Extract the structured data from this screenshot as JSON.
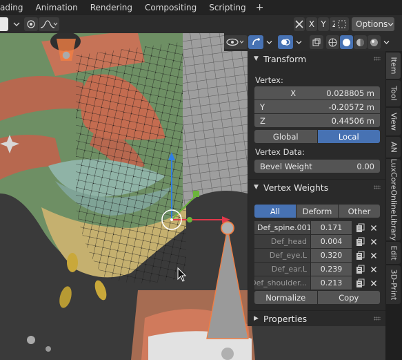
{
  "menu": {
    "tabs": [
      "ading",
      "Animation",
      "Rendering",
      "Compositing",
      "Scripting"
    ],
    "add_tab": "+"
  },
  "header": {
    "axes": [
      "X",
      "Y",
      "Z"
    ],
    "options_label": "Options",
    "options_chevron": "⌄"
  },
  "panel": {
    "transform": {
      "title": "Transform",
      "vertex_label": "Vertex:",
      "coords": [
        {
          "axis": "X",
          "value": "0.028805 m"
        },
        {
          "axis": "Y",
          "value": "-0.20572 m"
        },
        {
          "axis": "Z",
          "value": "0.44506 m"
        }
      ],
      "space": {
        "global": "Global",
        "local": "Local",
        "active": "Local"
      },
      "vertex_data_label": "Vertex Data:",
      "bevel": {
        "label": "Bevel Weight",
        "value": "0.00"
      }
    },
    "vertex_weights": {
      "title": "Vertex Weights",
      "filters": {
        "all": "All",
        "deform": "Deform",
        "other": "Other",
        "active": "All"
      },
      "rows": [
        {
          "name": "Def_spine.001",
          "value": "0.171",
          "active": true
        },
        {
          "name": "Def_head",
          "value": "0.004",
          "active": false
        },
        {
          "name": "Def_eye.L",
          "value": "0.320",
          "active": false
        },
        {
          "name": "Def_ear.L",
          "value": "0.239",
          "active": false
        },
        {
          "name": "Def_shoulder...",
          "value": "0.213",
          "active": false
        }
      ],
      "normalize_label": "Normalize",
      "copy_label": "Copy"
    },
    "properties": {
      "title": "Properties"
    }
  },
  "side_tabs": [
    "Item",
    "Tool",
    "View",
    "AN",
    "LuxCoreOnlineLibrary",
    "Edit",
    "3D-Print"
  ],
  "colors": {
    "accent": "#4772b3",
    "panel_bg": "#2a2a2a",
    "field": "#545454"
  }
}
